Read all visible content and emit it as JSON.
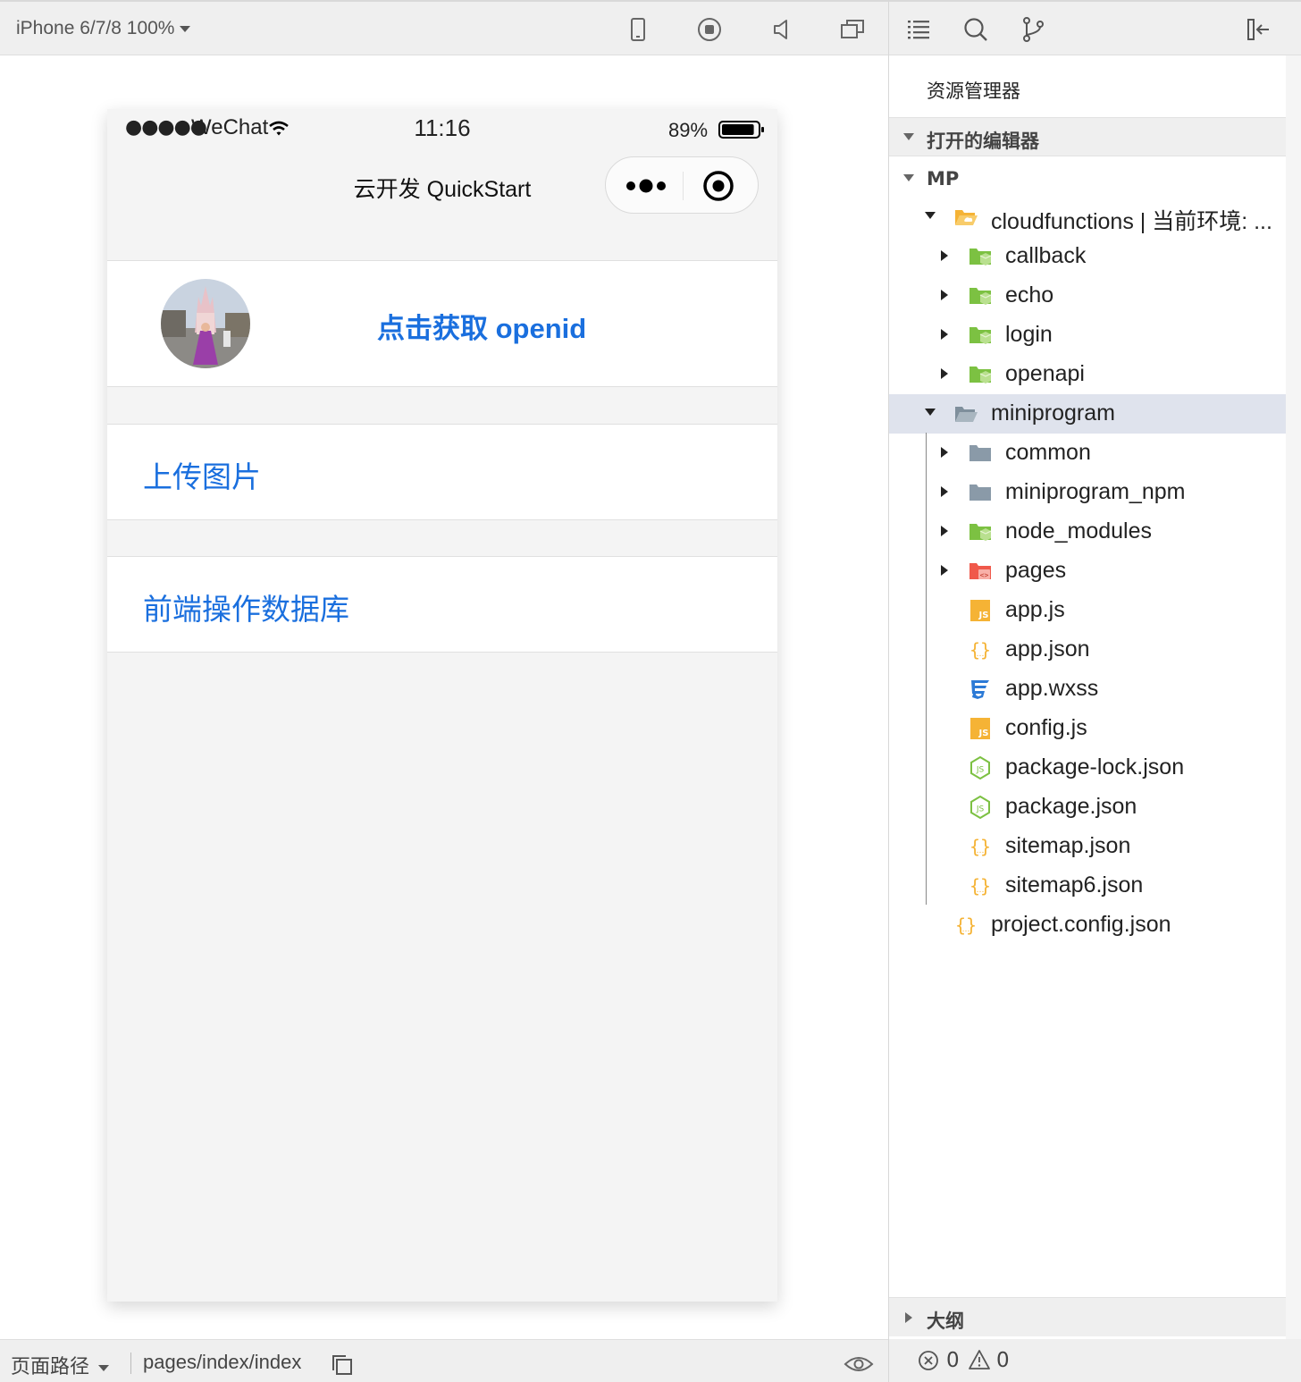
{
  "simulator": {
    "device": "iPhone 6/7/8 100%",
    "toolbar_icons": [
      "phone-icon",
      "record-icon",
      "volume-icon",
      "window-icon"
    ],
    "status_bar": {
      "signal": "●●●●●",
      "carrier": "WeChat",
      "time": "11:16",
      "battery": "89%",
      "battery_level": 0.89
    },
    "nav_title": "云开发 QuickStart",
    "openid_button": "点击获取 openid",
    "upload_link": "上传图片",
    "database_link": "前端操作数据库",
    "footer": {
      "path_label": "页面路径",
      "path_value": "pages/index/index"
    }
  },
  "explorer": {
    "toolbar_icons": [
      "list-icon",
      "search-icon",
      "branch-icon",
      "collapse-panel-icon"
    ],
    "title": "资源管理器",
    "open_editors": "打开的编辑器",
    "project": "MP",
    "tree": [
      {
        "name": "cloudfunctions | 当前环境: ...",
        "depth": 1,
        "expanded": true,
        "icon": "folder-open-yellow"
      },
      {
        "name": "callback",
        "depth": 2,
        "expanded": false,
        "icon": "folder-cloud-green"
      },
      {
        "name": "echo",
        "depth": 2,
        "expanded": false,
        "icon": "folder-cloud-green"
      },
      {
        "name": "login",
        "depth": 2,
        "expanded": false,
        "icon": "folder-cloud-green"
      },
      {
        "name": "openapi",
        "depth": 2,
        "expanded": false,
        "icon": "folder-cloud-green"
      },
      {
        "name": "miniprogram",
        "depth": 1,
        "expanded": true,
        "icon": "folder-open-gray",
        "selected": true
      },
      {
        "name": "common",
        "depth": 2,
        "expanded": false,
        "icon": "folder-gray"
      },
      {
        "name": "miniprogram_npm",
        "depth": 2,
        "expanded": false,
        "icon": "folder-gray"
      },
      {
        "name": "node_modules",
        "depth": 2,
        "expanded": false,
        "icon": "folder-cloud-green"
      },
      {
        "name": "pages",
        "depth": 2,
        "expanded": false,
        "icon": "folder-code-red"
      },
      {
        "name": "app.js",
        "depth": 2,
        "icon": "js-file"
      },
      {
        "name": "app.json",
        "depth": 2,
        "icon": "json-file"
      },
      {
        "name": "app.wxss",
        "depth": 2,
        "icon": "css-file"
      },
      {
        "name": "config.js",
        "depth": 2,
        "icon": "js-file"
      },
      {
        "name": "package-lock.json",
        "depth": 2,
        "icon": "node-file"
      },
      {
        "name": "package.json",
        "depth": 2,
        "icon": "node-file"
      },
      {
        "name": "sitemap.json",
        "depth": 2,
        "icon": "json-file"
      },
      {
        "name": "sitemap6.json",
        "depth": 2,
        "icon": "json-file"
      },
      {
        "name": "project.config.json",
        "depth": 1,
        "icon": "json-file"
      }
    ],
    "outline": "大纲",
    "footer": {
      "errors": "0",
      "warnings": "0"
    }
  },
  "colors": {
    "link_blue": "#1a6fde",
    "folder_green": "#7cc142",
    "folder_gray": "#8a9aa8",
    "folder_yellow": "#f5b335",
    "folder_red": "#f0594b",
    "js_yellow": "#f5b335",
    "css_blue": "#2c7ad6",
    "node_green": "#7cc142",
    "selected_row": "#dfe3ed"
  }
}
